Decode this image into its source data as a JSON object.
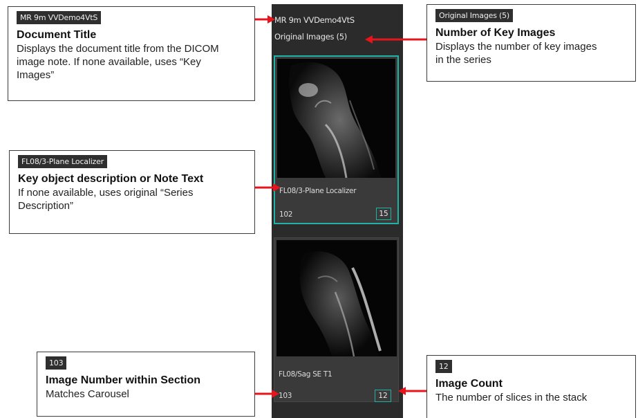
{
  "viewer": {
    "title": "MR 9m VVDemo4VtS",
    "subtitle": "Original Images (5)",
    "thumbnails": [
      {
        "label": "FL08/3-Plane Localizer",
        "image_number": "102",
        "image_count": "15",
        "selected": true
      },
      {
        "label": "FL08/Sag SE T1",
        "image_number": "103",
        "image_count": "12",
        "selected": false
      }
    ]
  },
  "callouts": {
    "document_title": {
      "chip": "MR 9m VVDemo4VtS",
      "heading": "Document Title",
      "description": "Displays the document title from the DICOM image note. If none available, uses “Key Images”"
    },
    "key_images": {
      "chip": "Original Images (5)",
      "heading": "Number of Key Images",
      "description": "Displays the number of key images in the series"
    },
    "key_object": {
      "chip": "FL08/3-Plane Localizer",
      "heading": "Key object description or Note Text",
      "description": "If none available, uses original “Series Description”"
    },
    "image_number": {
      "chip": "103",
      "heading": "Image Number within Section",
      "description": "Matches Carousel"
    },
    "image_count": {
      "chip": "12",
      "heading": "Image Count",
      "description": "The number of slices in the stack"
    }
  },
  "colors": {
    "panel_bg": "#2b2b2b",
    "accent_teal": "#1fb3a6",
    "arrow_red": "#e8141c",
    "chip_bg": "#2f2f2f"
  }
}
